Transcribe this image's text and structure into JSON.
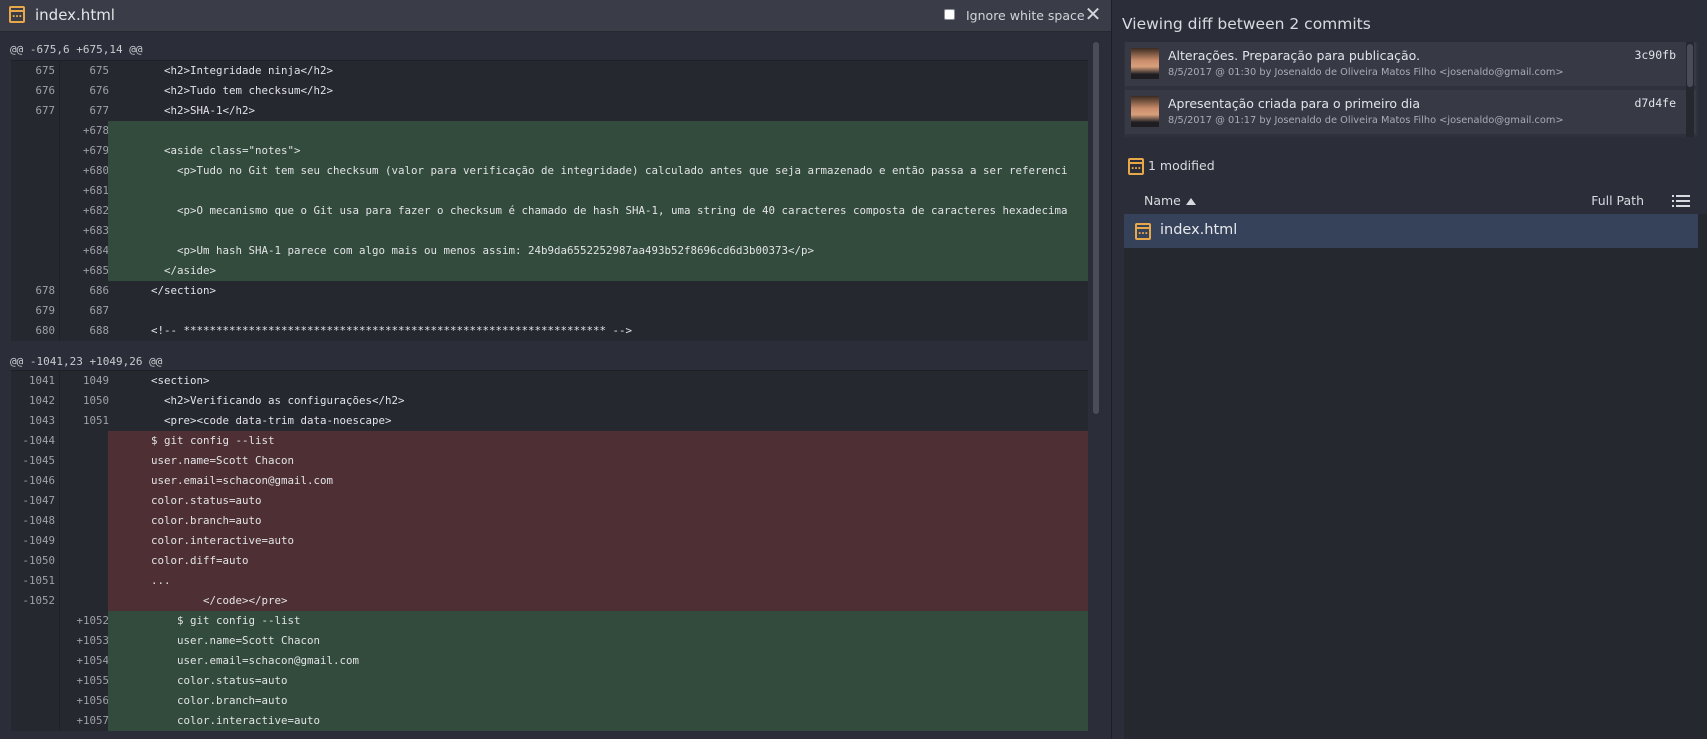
{
  "window": {
    "file_title": "index.html",
    "ignore_whitespace_label": "Ignore white space",
    "ignore_whitespace_checked": false,
    "close_glyph": "✕"
  },
  "diff": {
    "hunks": [
      {
        "header": "@@ -675,6 +675,14 @@",
        "lines": [
          {
            "type": "ctx",
            "old": "675",
            "new": "675",
            "code": "        <h2>Integridade ninja</h2>"
          },
          {
            "type": "ctx",
            "old": "676",
            "new": "676",
            "code": "        <h2>Tudo tem checksum</h2>"
          },
          {
            "type": "ctx",
            "old": "677",
            "new": "677",
            "code": "        <h2>SHA-1</h2>"
          },
          {
            "type": "add",
            "old": "",
            "new": "+678",
            "code": ""
          },
          {
            "type": "add",
            "old": "",
            "new": "+679",
            "code": "        <aside class=\"notes\">"
          },
          {
            "type": "add",
            "old": "",
            "new": "+680",
            "code": "          <p>Tudo no Git tem seu checksum (valor para verificação de integridade) calculado antes que seja armazenado e então passa a ser referenci"
          },
          {
            "type": "add",
            "old": "",
            "new": "+681",
            "code": ""
          },
          {
            "type": "add",
            "old": "",
            "new": "+682",
            "code": "          <p>O mecanismo que o Git usa para fazer o checksum é chamado de hash SHA-1, uma string de 40 caracteres composta de caracteres hexadecima"
          },
          {
            "type": "add",
            "old": "",
            "new": "+683",
            "code": ""
          },
          {
            "type": "add",
            "old": "",
            "new": "+684",
            "code": "          <p>Um hash SHA-1 parece com algo mais ou menos assim: 24b9da6552252987aa493b52f8696cd6d3b00373</p>"
          },
          {
            "type": "add",
            "old": "",
            "new": "+685",
            "code": "        </aside>"
          },
          {
            "type": "ctx",
            "old": "678",
            "new": "686",
            "code": "      </section>"
          },
          {
            "type": "ctx",
            "old": "679",
            "new": "687",
            "code": ""
          },
          {
            "type": "ctx",
            "old": "680",
            "new": "688",
            "code": "      <!-- ***************************************************************** -->"
          }
        ]
      },
      {
        "header": "@@ -1041,23 +1049,26 @@",
        "lines": [
          {
            "type": "ctx",
            "old": "1041",
            "new": "1049",
            "code": "      <section>"
          },
          {
            "type": "ctx",
            "old": "1042",
            "new": "1050",
            "code": "        <h2>Verificando as configurações</h2>"
          },
          {
            "type": "ctx",
            "old": "1043",
            "new": "1051",
            "code": "        <pre><code data-trim data-noescape>"
          },
          {
            "type": "del",
            "old": "-1044",
            "new": "",
            "code": "      $ git config --list"
          },
          {
            "type": "del",
            "old": "-1045",
            "new": "",
            "code": "      user.name=Scott Chacon"
          },
          {
            "type": "del",
            "old": "-1046",
            "new": "",
            "code": "      user.email=schacon@gmail.com"
          },
          {
            "type": "del",
            "old": "-1047",
            "new": "",
            "code": "      color.status=auto"
          },
          {
            "type": "del",
            "old": "-1048",
            "new": "",
            "code": "      color.branch=auto"
          },
          {
            "type": "del",
            "old": "-1049",
            "new": "",
            "code": "      color.interactive=auto"
          },
          {
            "type": "del",
            "old": "-1050",
            "new": "",
            "code": "      color.diff=auto"
          },
          {
            "type": "del",
            "old": "-1051",
            "new": "",
            "code": "      ..."
          },
          {
            "type": "del",
            "old": "-1052",
            "new": "",
            "code": "              </code></pre>"
          },
          {
            "type": "add",
            "old": "",
            "new": "+1052",
            "code": "          $ git config --list"
          },
          {
            "type": "add",
            "old": "",
            "new": "+1053",
            "code": "          user.name=Scott Chacon"
          },
          {
            "type": "add",
            "old": "",
            "new": "+1054",
            "code": "          user.email=schacon@gmail.com"
          },
          {
            "type": "add",
            "old": "",
            "new": "+1055",
            "code": "          color.status=auto"
          },
          {
            "type": "add",
            "old": "",
            "new": "+1056",
            "code": "          color.branch=auto"
          },
          {
            "type": "add",
            "old": "",
            "new": "+1057",
            "code": "          color.interactive=auto"
          }
        ]
      }
    ]
  },
  "commits_panel": {
    "heading": "Viewing diff between 2 commits",
    "commits": [
      {
        "message": "Alterações. Preparação para publicação.",
        "hash": "3c90fb",
        "meta": "8/5/2017 @ 01:30 by Josenaldo de Oliveira Matos Filho <josenaldo@gmail.com>"
      },
      {
        "message": "Apresentação criada para o primeiro dia",
        "hash": "d7d4fe",
        "meta": "8/5/2017 @ 01:17 by Josenaldo de Oliveira Matos Filho <josenaldo@gmail.com>"
      }
    ]
  },
  "files_panel": {
    "summary": "1 modified",
    "name_header": "Name",
    "full_path_label": "Full Path",
    "files": [
      {
        "name": "index.html",
        "status": "modified"
      }
    ]
  },
  "colors": {
    "added_bg": "#324b3c",
    "removed_bg": "#4e3034",
    "file_icon": "#e7a84a",
    "selected_row": "#36415a"
  }
}
